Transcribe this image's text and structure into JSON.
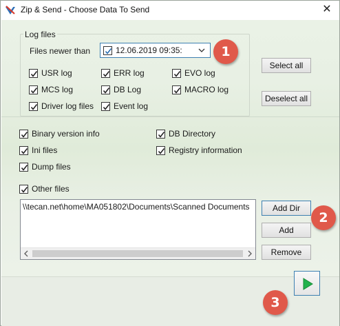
{
  "window": {
    "title": "Zip & Send - Choose Data To Send",
    "close_glyph": "✕"
  },
  "colors": {
    "accent_blue": "#3c7fb1",
    "badge_red": "#e0594a",
    "go_green": "#22b14c",
    "background_green": "#e0ebd9"
  },
  "log_files": {
    "legend": "Log files",
    "files_newer_than_label": "Files newer than",
    "date_value": "12.06.2019 09:35:",
    "date_checked": true,
    "checkboxes": [
      {
        "label": "USR log",
        "checked": true
      },
      {
        "label": "ERR log",
        "checked": true
      },
      {
        "label": "EVO log",
        "checked": true
      },
      {
        "label": "MCS log",
        "checked": true
      },
      {
        "label": "DB Log",
        "checked": true
      },
      {
        "label": "MACRO log",
        "checked": true
      },
      {
        "label": "Driver log files",
        "checked": true
      },
      {
        "label": "Event log",
        "checked": true
      }
    ],
    "select_all_label": "Select all",
    "deselect_all_label": "Deselect all"
  },
  "data_options": [
    {
      "label": "Binary version info",
      "checked": true
    },
    {
      "label": "DB Directory",
      "checked": true
    },
    {
      "label": "Ini files",
      "checked": true
    },
    {
      "label": "Registry information",
      "checked": true
    },
    {
      "label": "Dump files",
      "checked": true
    }
  ],
  "other_files": {
    "label": "Other files",
    "checked": true,
    "items": [
      "\\\\tecan.net\\home\\MA051802\\Documents\\Scanned Documents"
    ],
    "add_dir_label": "Add Dir",
    "add_label": "Add",
    "remove_label": "Remove"
  },
  "badges": [
    "1",
    "2",
    "3"
  ],
  "footer": {
    "next_icon": "play-arrow-icon"
  }
}
